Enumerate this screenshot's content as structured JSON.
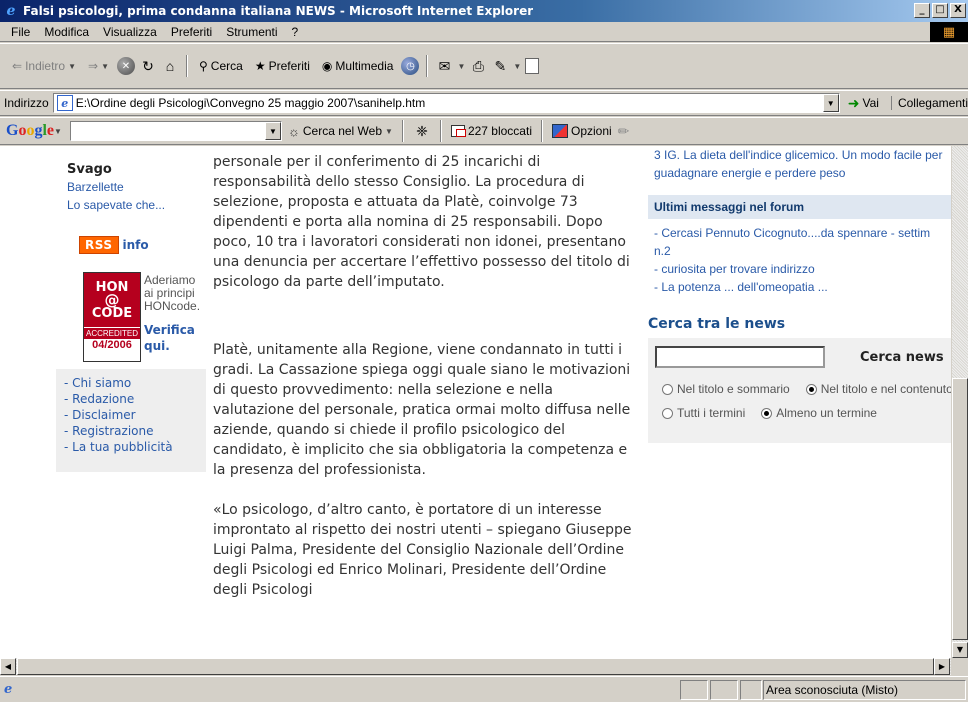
{
  "window": {
    "title": "Falsi psicologi, prima condanna italiana NEWS - Microsoft Internet Explorer",
    "buttons": [
      "_",
      "□",
      "X"
    ]
  },
  "menu": [
    {
      "label": "File"
    },
    {
      "label": "Modifica"
    },
    {
      "label": "Visualizza"
    },
    {
      "label": "Preferiti"
    },
    {
      "label": "Strumenti"
    },
    {
      "label": "?"
    }
  ],
  "toolbar": {
    "back": "Indietro",
    "search": "Cerca",
    "favorites": "Preferiti",
    "multimedia": "Multimedia"
  },
  "address": {
    "label": "Indirizzo",
    "url": "E:\\Ordine degli Psicologi\\Convegno 25 maggio 2007\\sanihelp.htm",
    "go": "Vai",
    "links": "Collegamenti"
  },
  "googlebar": {
    "logo": [
      "G",
      "o",
      "o",
      "g",
      "l",
      "e"
    ],
    "search_web": "Cerca nel Web",
    "blocked": "227 bloccati",
    "options": "Opzioni"
  },
  "left": {
    "svago_title": "Svago",
    "svago_links": [
      "Barzellette",
      "Lo sapevate che..."
    ],
    "rss": "RSS",
    "info": "info",
    "hon": {
      "line1": "HON",
      "line2": "@",
      "line3": "CODE",
      "accredited": "ACCREDITED",
      "date": "04/2006",
      "text": [
        "Aderiamo",
        "ai principi",
        "HONcode."
      ],
      "verify1": "Verifica",
      "verify2": "qui."
    },
    "nav_links": [
      "- Chi siamo",
      "- Redazione",
      "- Disclaimer",
      "- Registrazione",
      "- La tua pubblicità"
    ]
  },
  "article": {
    "paragraphs": [
      "personale per il conferimento di 25 incarichi di responsabilità dello stesso Consiglio. La procedura di selezione, proposta e attuata da Platè, coinvolge 73 dipendenti e porta alla nomina di 25 responsabili. Dopo poco, 10 tra i lavoratori considerati non idonei, presentano una denuncia per accertare l’effettivo possesso del titolo di psicologo da parte dell’imputato.",
      "Platè, unitamente alla Regione, viene condannato in tutti i gradi. La Cassazione spiega oggi quale siano le motivazioni di questo provvedimento: nella selezione e nella valutazione del personale, pratica ormai molto diffusa nelle aziende, quando si chiede il profilo psicologico del candidato, è implicito che sia obbligatoria la competenza e la presenza del professionista.",
      "«Lo psicologo, d’altro canto, è portatore di un interesse improntato al rispetto dei nostri utenti – spiegano Giuseppe Luigi Palma, Presidente del Consiglio Nazionale dell’Ordine degli Psicologi ed Enrico Molinari, Presidente dell’Ordine degli Psicologi"
    ]
  },
  "right": {
    "top_item_line1": "3  IG. La dieta dell'indice glicemico. Un modo facile per",
    "top_item_line2": "guadagnare energie e perdere peso",
    "forum_title": "Ultimi messaggi nel forum",
    "forum_items": [
      "- Cercasi Pennuto Cicognuto....da spennare - settim",
      "n.2",
      "- curiosita per trovare indirizzo",
      "- La potenza ... dell'omeopatia ..."
    ],
    "news_title": "Cerca tra le news",
    "news_button": "Cerca news",
    "radio1a": "Nel titolo e sommario",
    "radio1b": "Nel titolo e nel contenuto",
    "radio2a": "Tutti i termini",
    "radio2b": "Almeno un termine"
  },
  "status": {
    "zone": "Area sconosciuta (Misto)"
  }
}
